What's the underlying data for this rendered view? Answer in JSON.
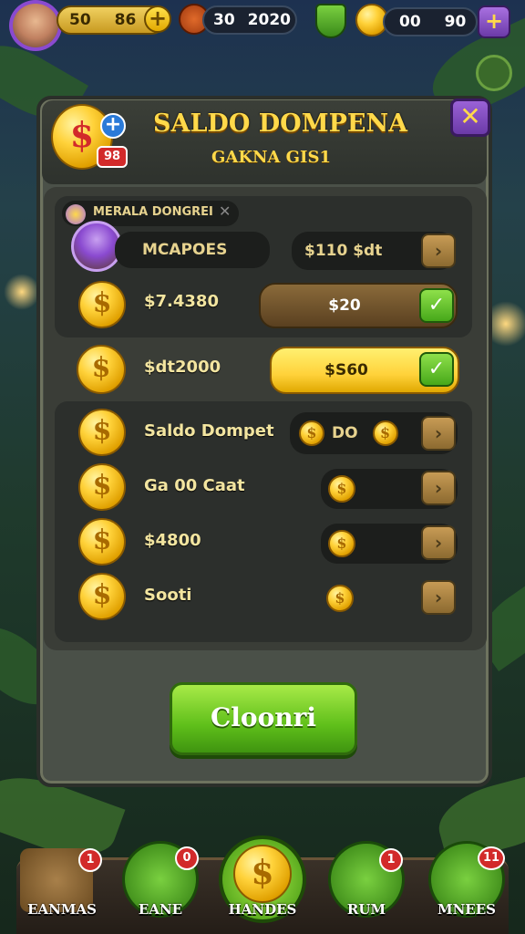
{
  "top_bar": {
    "player_values": [
      "50",
      "86"
    ],
    "currency_value": "30",
    "currency_value_2": "2020",
    "gem_values": [
      "00",
      "90"
    ]
  },
  "panel": {
    "title": "SALDO DOMPENA",
    "subtitle": "GAKNA GIS1",
    "header_badge": "98",
    "section_label": "MERALA DONGREI",
    "close_symbol": "✕"
  },
  "rows": [
    {
      "label": "MCAPOES",
      "value": "$110 $dt"
    },
    {
      "label": "$7.4380",
      "value": "$20"
    },
    {
      "label": "$dt2000",
      "value": "$S60"
    },
    {
      "label": "Saldo Dompet",
      "value": "DO"
    },
    {
      "label": "Ga 00 Caat",
      "value": ""
    },
    {
      "label": "$4800",
      "value": ""
    },
    {
      "label": "Sooti",
      "value": ""
    }
  ],
  "confirm_label": "Cloonri",
  "nav": [
    {
      "label": "EANMAS",
      "badge": "1"
    },
    {
      "label": "EANE",
      "badge": "0"
    },
    {
      "label": "HANDES",
      "badge": ""
    },
    {
      "label": "RUM",
      "badge": "1"
    },
    {
      "label": "MNEES",
      "badge": "11"
    }
  ],
  "colors": {
    "gold": "#ffd94a",
    "green": "#5fbf1a",
    "purple": "#6b3aa8",
    "panel": "#4a5048"
  }
}
